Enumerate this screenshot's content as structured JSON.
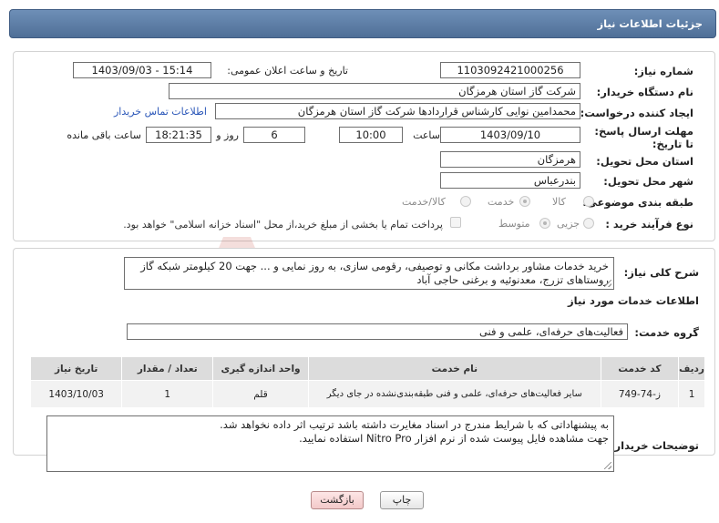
{
  "header": {
    "title": "جزئیات اطلاعات نیاز"
  },
  "form": {
    "need_number_label": "شماره نیاز:",
    "need_number": "1103092421000256",
    "announce_label": "تاریخ و ساعت اعلان عمومی:",
    "announce_value": "1403/09/03 - 15:14",
    "buyer_org_label": "نام دستگاه خریدار:",
    "buyer_org": "شرکت گاز استان هرمزگان",
    "creator_label": "ایجاد کننده درخواست:",
    "creator": "محمدامین نوایی کارشناس قراردادها شرکت گاز استان هرمزگان",
    "contact_link": "اطلاعات تماس خریدار",
    "deadline_label": "مهلت ارسال پاسخ: تا تاریخ:",
    "deadline_date": "1403/09/10",
    "time_label": "ساعت",
    "deadline_time": "10:00",
    "days_value": "6",
    "days_label": "روز و",
    "remaining_time": "18:21:35",
    "remaining_label": "ساعت باقی مانده",
    "province_label": "استان محل تحویل:",
    "province": "هرمزگان",
    "city_label": "شهر محل تحویل:",
    "city": "بندرعباس",
    "category_label": "طبقه بندی موضوعی:",
    "category_options": [
      "کالا",
      "خدمت",
      "کالا/خدمت"
    ],
    "category_selected": "خدمت",
    "process_label": "نوع فرآیند خرید :",
    "process_options": [
      "جزیی",
      "متوسط"
    ],
    "process_selected": "متوسط",
    "payment_note": "پرداخت تمام یا بخشی از مبلغ خرید،از محل \"اسناد خزانه اسلامی\" خواهد بود."
  },
  "summary": {
    "label": "شرح کلی نیاز:",
    "text": "خرید خدمات مشاور برداشت مکانی و توصیفی، رقومی سازی، به روز نمایی و ... جهت 20 کیلومتر شبکه گاز روستاهای تزرج، معدنوئیه و برغنی حاجی آباد"
  },
  "services": {
    "section_title": "اطلاعات خدمات مورد نیاز",
    "group_label": "گروه خدمت:",
    "group_value": "فعالیت‌های حرفه‌ای، علمی و فنی",
    "columns": [
      "ردیف",
      "کد خدمت",
      "نام خدمت",
      "واحد اندازه گیری",
      "تعداد / مقدار",
      "تاریخ نیاز"
    ],
    "rows": [
      {
        "row": "1",
        "code": "ز-74-749",
        "name": "سایر فعالیت‌های حرفه‌ای، علمی و فنی طبقه‌بندی‌نشده در جای دیگر",
        "unit": "قلم",
        "qty": "1",
        "date": "1403/10/03"
      }
    ]
  },
  "buyer_notes": {
    "label": "توضیحات خریدار:",
    "line1": "به پیشنهاداتی که با شرایط مندرج در اسناد مغایرت داشته باشد ترتیب اثر داده نخواهد شد.",
    "line2": "جهت مشاهده فایل پیوست شده از نرم افزار Nitro Pro استفاده نمایید."
  },
  "buttons": {
    "print": "چاپ",
    "back": "بازگشت"
  },
  "colors": {
    "header_bg": "#5b7ba3",
    "link": "#2a56b8",
    "watermark": "#c0392b"
  }
}
